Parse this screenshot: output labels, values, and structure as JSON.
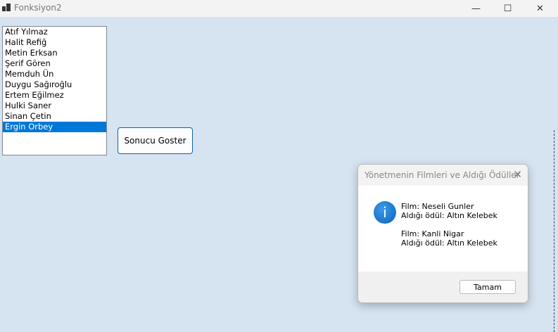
{
  "window": {
    "title": "Fonksiyon2",
    "minimize": "—",
    "maximize": "☐",
    "close": "✕"
  },
  "listbox": {
    "items": [
      "Atıf Yılmaz",
      "Halit Refiğ",
      "Metin Erksan",
      "Şerif Gören",
      "Memduh Ün",
      "Duygu Sağıroğlu",
      "Ertem Eğilmez",
      "Hulki Saner",
      "Sinan Çetin",
      "Ergin Orbey"
    ],
    "selected": "Ergin Orbey"
  },
  "button": {
    "label": "Sonucu Goster"
  },
  "dialog": {
    "title": "Yönetmenin Filmleri ve Aldığı Ödüller",
    "close": "✕",
    "icon": "info-icon",
    "lines": [
      "Film: Neseli Gunler",
      "Aldığı ödül: Altın Kelebek",
      "",
      "Film: Kanli Nigar",
      "Aldığı ödül: Altın Kelebek"
    ],
    "ok": "Tamam"
  },
  "colors": {
    "selection": "#0078d7",
    "background": "#d6e3f0"
  }
}
